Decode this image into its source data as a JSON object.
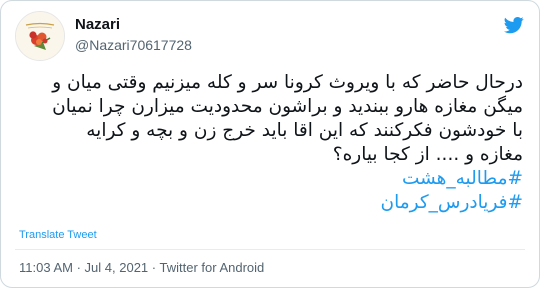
{
  "author": {
    "display_name": "Nazari",
    "handle": "@Nazari70617728",
    "avatar_icon": "flower-bouquet-avatar"
  },
  "brand": {
    "icon": "twitter-bird-icon",
    "color": "#1d9bf0"
  },
  "tweet": {
    "lines": [
      "درحال حاضر که با ویروث کرونا سر و کله میزنیم وقتی میان و",
      "میگن مغازه هارو ببندید و براشون محدودیت میزارن چرا نمیان",
      "با خودشون فکرکنند که این اقا باید خرج زن و بچه و کرایه",
      "مغازه و .... از کجا بیاره؟"
    ],
    "hashtags": [
      "#مطالبه_هشت",
      "#فریادرس_کرمان"
    ]
  },
  "translate_label": "Translate Tweet",
  "meta": {
    "time": "11:03 AM",
    "separator": "·",
    "date": "Jul 4, 2021",
    "source": "Twitter for Android"
  }
}
